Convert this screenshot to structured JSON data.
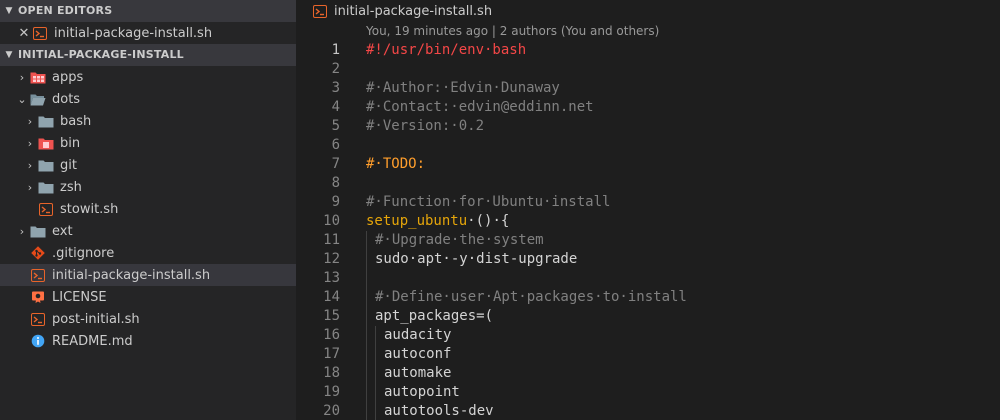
{
  "sidebar": {
    "open_editors_title": "OPEN EDITORS",
    "open_editor_file": "initial-package-install.sh",
    "workspace_title": "INITIAL-PACKAGE-INSTALL",
    "items": [
      {
        "label": "apps"
      },
      {
        "label": "dots"
      },
      {
        "label": "bash"
      },
      {
        "label": "bin"
      },
      {
        "label": "git"
      },
      {
        "label": "zsh"
      },
      {
        "label": "stowit.sh"
      },
      {
        "label": "ext"
      },
      {
        "label": ".gitignore"
      },
      {
        "label": "initial-package-install.sh"
      },
      {
        "label": "LICENSE"
      },
      {
        "label": "post-initial.sh"
      },
      {
        "label": "README.md"
      }
    ]
  },
  "editor": {
    "tab_title": "initial-package-install.sh",
    "codelens": "You, 19 minutes ago | 2 authors (You and others)",
    "lines": [
      {
        "n": "1",
        "text": "#!/usr/bin/env·bash"
      },
      {
        "n": "2",
        "text": ""
      },
      {
        "n": "3",
        "text": "#·Author:·Edvin·Dunaway"
      },
      {
        "n": "4",
        "text": "#·Contact:·edvin@eddinn.net"
      },
      {
        "n": "5",
        "text": "#·Version:·0.2"
      },
      {
        "n": "6",
        "text": ""
      },
      {
        "n": "7",
        "text": "#·TODO:"
      },
      {
        "n": "8",
        "text": ""
      },
      {
        "n": "9",
        "text": "#·Function·for·Ubuntu·install"
      },
      {
        "n": "10",
        "fn": "setup_ubuntu",
        "rest": "·()·{"
      },
      {
        "n": "11",
        "text": "#·Upgrade·the·system"
      },
      {
        "n": "12",
        "text": "sudo·apt·-y·dist-upgrade"
      },
      {
        "n": "13",
        "text": ""
      },
      {
        "n": "14",
        "text": "#·Define·user·Apt·packages·to·install"
      },
      {
        "n": "15",
        "text": "apt_packages=("
      },
      {
        "n": "16",
        "text": "audacity"
      },
      {
        "n": "17",
        "text": "autoconf"
      },
      {
        "n": "18",
        "text": "automake"
      },
      {
        "n": "19",
        "text": "autopoint"
      },
      {
        "n": "20",
        "text": "autotools-dev"
      }
    ]
  },
  "colors": {
    "sidebar_bg": "#252526",
    "editor_bg": "#1e1e1e",
    "selected_row": "#37373d",
    "shell_icon": "#e8642a",
    "folder_icon": "#90a4ae",
    "folder_red": "#ef5350",
    "info_icon": "#42a5f5",
    "comment": "#808080",
    "shebang": "#f44747",
    "todo": "#ff9e2c",
    "function_name": "#e5a50a"
  }
}
